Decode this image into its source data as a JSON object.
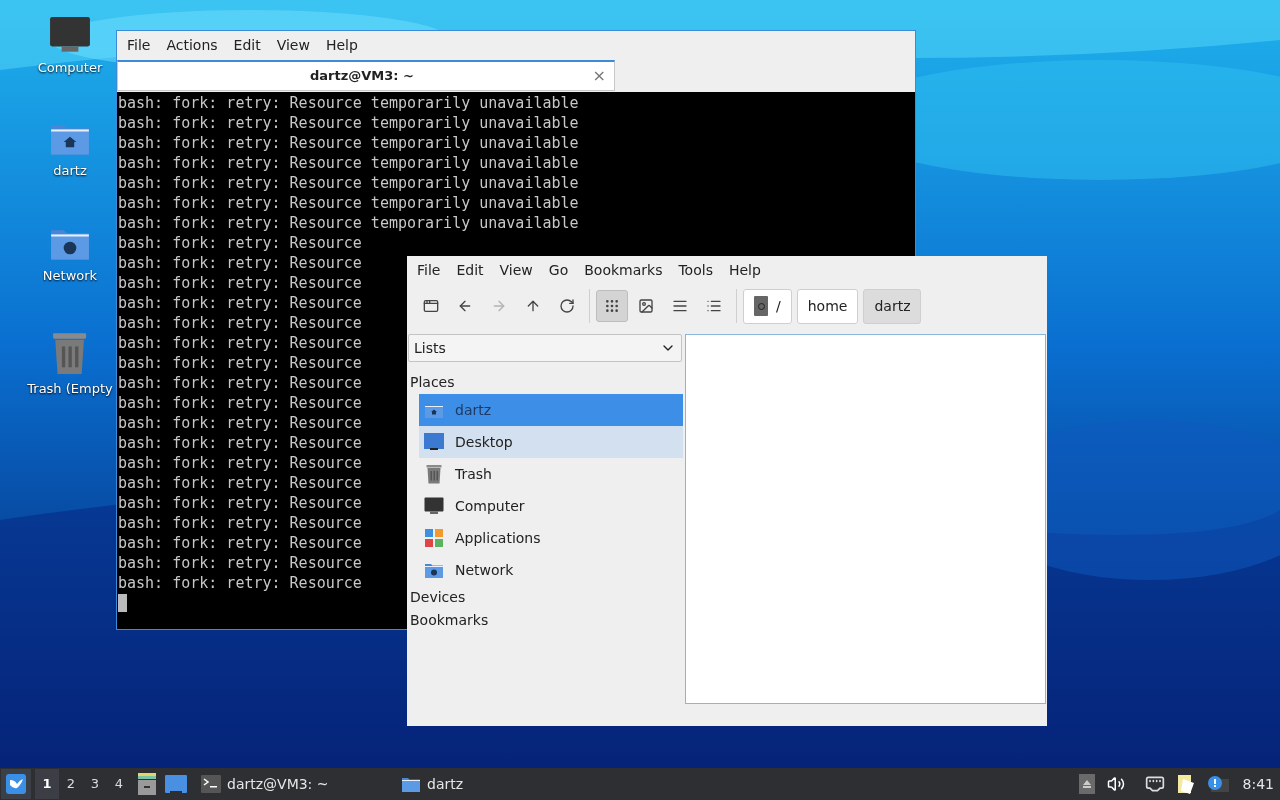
{
  "desktop_icons": [
    {
      "label": "Computer",
      "kind": "computer"
    },
    {
      "label": "dartz",
      "kind": "home"
    },
    {
      "label": "Network",
      "kind": "network"
    },
    {
      "label": "Trash (Empty",
      "kind": "trash"
    }
  ],
  "terminal": {
    "menu": [
      "File",
      "Actions",
      "Edit",
      "View",
      "Help"
    ],
    "tab": {
      "title": "dartz@VM3: ~",
      "close": "×"
    },
    "lines": [
      "bash: fork: retry: Resource temporarily unavailable",
      "bash: fork: retry: Resource temporarily unavailable",
      "bash: fork: retry: Resource temporarily unavailable",
      "bash: fork: retry: Resource temporarily unavailable",
      "bash: fork: retry: Resource temporarily unavailable",
      "bash: fork: retry: Resource temporarily unavailable",
      "bash: fork: retry: Resource temporarily unavailable",
      "bash: fork: retry: Resource",
      "bash: fork: retry: Resource",
      "bash: fork: retry: Resource",
      "bash: fork: retry: Resource",
      "bash: fork: retry: Resource",
      "bash: fork: retry: Resource",
      "bash: fork: retry: Resource",
      "bash: fork: retry: Resource",
      "bash: fork: retry: Resource",
      "bash: fork: retry: Resource",
      "bash: fork: retry: Resource",
      "bash: fork: retry: Resource",
      "bash: fork: retry: Resource",
      "bash: fork: retry: Resource",
      "bash: fork: retry: Resource",
      "bash: fork: retry: Resource",
      "bash: fork: retry: Resource",
      "bash: fork: retry: Resource"
    ]
  },
  "file_manager": {
    "menu": [
      "File",
      "Edit",
      "View",
      "Go",
      "Bookmarks",
      "Tools",
      "Help"
    ],
    "toolbar": [
      {
        "kind": "new-tab",
        "selected": false,
        "disabled": false
      },
      {
        "kind": "back",
        "selected": false,
        "disabled": false
      },
      {
        "kind": "forward",
        "selected": false,
        "disabled": true
      },
      {
        "kind": "up",
        "selected": false,
        "disabled": false
      },
      {
        "kind": "reload",
        "selected": false,
        "disabled": false
      },
      {
        "kind": "icon-view",
        "selected": true,
        "disabled": false
      },
      {
        "kind": "thumbnail-view",
        "selected": false,
        "disabled": false
      },
      {
        "kind": "compact-view",
        "selected": false,
        "disabled": false
      },
      {
        "kind": "detailed-view",
        "selected": false,
        "disabled": false
      }
    ],
    "path": [
      {
        "label": "/",
        "kind": "root",
        "selected": false
      },
      {
        "label": "home",
        "kind": "folder",
        "selected": false
      },
      {
        "label": "dartz",
        "kind": "folder",
        "selected": true
      }
    ],
    "side_pane_mode": "Lists",
    "sections": [
      {
        "label": "Places",
        "items": [
          {
            "label": "dartz",
            "kind": "home",
            "selected": true,
            "highlighted": false
          },
          {
            "label": "Desktop",
            "kind": "desktop",
            "selected": false,
            "highlighted": true
          },
          {
            "label": "Trash",
            "kind": "trash",
            "selected": false,
            "highlighted": false
          },
          {
            "label": "Computer",
            "kind": "computer",
            "selected": false,
            "highlighted": false
          },
          {
            "label": "Applications",
            "kind": "applications",
            "selected": false,
            "highlighted": false
          },
          {
            "label": "Network",
            "kind": "network",
            "selected": false,
            "highlighted": false
          }
        ]
      },
      {
        "label": "Devices"
      },
      {
        "label": "Bookmarks"
      }
    ]
  },
  "taskbar": {
    "workspaces": [
      {
        "label": "1",
        "selected": true
      },
      {
        "label": "2",
        "selected": false
      },
      {
        "label": "3",
        "selected": false
      },
      {
        "label": "4",
        "selected": false
      }
    ],
    "tasks": [
      {
        "label": "dartz@VM3: ~",
        "kind": "terminal"
      },
      {
        "label": "dartz",
        "kind": "folder"
      }
    ],
    "clock": "8:41"
  }
}
